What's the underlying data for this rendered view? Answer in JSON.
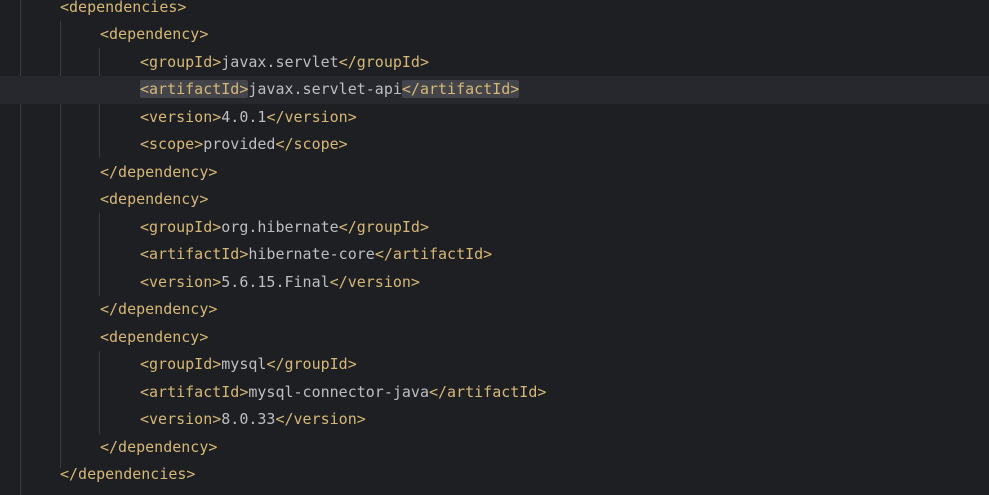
{
  "editor": {
    "lines": [
      {
        "indent": 1,
        "open": "<dependencies>",
        "text": "",
        "close": ""
      },
      {
        "indent": 2,
        "open": "<dependency>",
        "text": "",
        "close": ""
      },
      {
        "indent": 3,
        "open": "<groupId>",
        "text": "javax.servlet",
        "close": "</groupId>"
      },
      {
        "indent": 3,
        "open": "<artifactId>",
        "text": "javax.servlet-api",
        "close": "</artifactId>",
        "current": true,
        "highlight": true
      },
      {
        "indent": 3,
        "open": "<version>",
        "text": "4.0.1",
        "close": "</version>"
      },
      {
        "indent": 3,
        "open": "<scope>",
        "text": "provided",
        "close": "</scope>"
      },
      {
        "indent": 2,
        "open": "</dependency>",
        "text": "",
        "close": ""
      },
      {
        "indent": 2,
        "open": "<dependency>",
        "text": "",
        "close": ""
      },
      {
        "indent": 3,
        "open": "<groupId>",
        "text": "org.hibernate",
        "close": "</groupId>"
      },
      {
        "indent": 3,
        "open": "<artifactId>",
        "text": "hibernate-core",
        "close": "</artifactId>"
      },
      {
        "indent": 3,
        "open": "<version>",
        "text": "5.6.15.Final",
        "close": "</version>"
      },
      {
        "indent": 2,
        "open": "</dependency>",
        "text": "",
        "close": ""
      },
      {
        "indent": 2,
        "open": "<dependency>",
        "text": "",
        "close": ""
      },
      {
        "indent": 3,
        "open": "<groupId>",
        "text": "mysql",
        "close": "</groupId>"
      },
      {
        "indent": 3,
        "open": "<artifactId>",
        "text": "mysql-connector-java",
        "close": "</artifactId>"
      },
      {
        "indent": 3,
        "open": "<version>",
        "text": "8.0.33",
        "close": "</version>"
      },
      {
        "indent": 2,
        "open": "</dependency>",
        "text": "",
        "close": ""
      },
      {
        "indent": 1,
        "open": "</dependencies>",
        "text": "",
        "close": ""
      }
    ]
  },
  "colors": {
    "background": "#1e1f22",
    "tag": "#d5b778",
    "text": "#bcbec4",
    "current_line": "#26282e",
    "tag_highlight": "#43454a",
    "indent_guide": "#393b40"
  }
}
